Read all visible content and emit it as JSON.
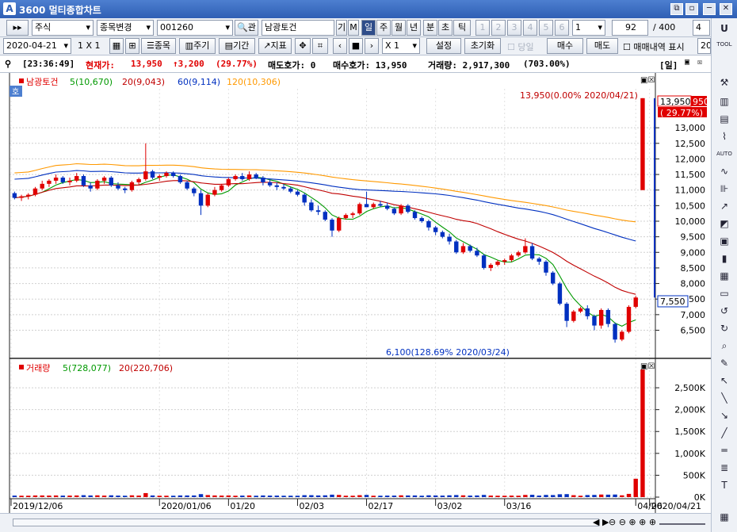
{
  "window": {
    "title": "3600 멀티종합차트",
    "logo": "A",
    "btn_restore": "⧉",
    "btn_min": "─",
    "btn_pin": "▫",
    "btn_close": "✕"
  },
  "toolbar1": {
    "market": "주식",
    "stock_change": "종목변경",
    "code": "001260",
    "search_icon_label": "🔍",
    "tab_sym": "관",
    "stock_name": "남광토건",
    "btn_gi": "기",
    "btn_m": "M",
    "periods": [
      "일",
      "주",
      "월",
      "년",
      "분",
      "초",
      "틱"
    ],
    "selected_period": "일",
    "nums": [
      "1",
      "2",
      "3",
      "4",
      "5",
      "6"
    ],
    "num_select": "1",
    "count": "92",
    "total": "/ 400",
    "extra": "4"
  },
  "toolbar2": {
    "date": "2020-04-21",
    "layout": "1 X 1",
    "btn_stock": "종목",
    "btn_period": "주기",
    "btn_range": "기간",
    "btn_indicator": "지표",
    "zoom": "X 1",
    "btn_settings": "설정",
    "btn_reset": "초기화",
    "chk_today": "당일",
    "btn_buy": "매수",
    "btn_sell": "매도",
    "chk_trades": "매매내역 표시",
    "extra": "20"
  },
  "info": {
    "time": "[23:36:49]",
    "price_label": "현재가:",
    "price": "13,950",
    "change": "↑3,200",
    "change_pct": "(29.77%)",
    "ask_label": "매도호가: 0",
    "bid_label": "매수호가: 13,950",
    "volume_label": "거래량: 2,917,300",
    "volume_pct": "(703.00%)",
    "period_tag": "[일]"
  },
  "price_panel": {
    "legend_name": "남광토건",
    "legend_ma5": "5(10,670)",
    "legend_ma20": "20(9,043)",
    "legend_ma60": "60(9,114)",
    "legend_ma120": "120(10,306)",
    "ho_badge": "호",
    "high_annotation": "13,950(0.00% 2020/04/21)",
    "low_annotation": "6,100(128.69% 2020/03/24)",
    "current_price_tag": "13,950",
    "current_price_tag_suffix": "950",
    "current_pct_tag": "( 29.77%)",
    "marker_price_tag": "7,550"
  },
  "volume_panel": {
    "legend_name": "거래량",
    "legend_ma5": "5(728,077)",
    "legend_ma20": "20(220,706)"
  },
  "chart_data": [
    {
      "type": "candlestick",
      "title": "남광토건",
      "x_tick_labels": [
        "2019/12/06",
        "2020/01/06",
        "01/20",
        "02/03",
        "02/17",
        "03/02",
        "03/16",
        "04/06",
        "2020/04/21"
      ],
      "y_tick_labels": [
        "6,500",
        "7,000",
        "7,500",
        "8,000",
        "8,500",
        "9,000",
        "9,500",
        "10,000",
        "10,500",
        "11,000",
        "11,500",
        "12,000",
        "12,500",
        "13,000"
      ],
      "ylim": [
        5800,
        14200
      ],
      "series": [
        {
          "name": "5",
          "values": [
            10670
          ]
        },
        {
          "name": "20",
          "values": [
            9043
          ]
        },
        {
          "name": "60",
          "values": [
            9114
          ]
        },
        {
          "name": "120",
          "values": [
            10306
          ]
        }
      ],
      "candles_ohlc": [
        [
          10900,
          10950,
          10700,
          10750
        ],
        [
          10750,
          10850,
          10650,
          10800
        ],
        [
          10800,
          10900,
          10700,
          10850
        ],
        [
          10850,
          11100,
          10800,
          11050
        ],
        [
          11050,
          11300,
          11000,
          11200
        ],
        [
          11200,
          11350,
          11100,
          11300
        ],
        [
          11300,
          11500,
          11200,
          11400
        ],
        [
          11400,
          11450,
          11200,
          11250
        ],
        [
          11250,
          11400,
          11150,
          11300
        ],
        [
          11300,
          11550,
          11250,
          11450
        ],
        [
          11450,
          11500,
          11100,
          11150
        ],
        [
          11150,
          11250,
          10950,
          11050
        ],
        [
          11050,
          11350,
          11000,
          11300
        ],
        [
          11300,
          11450,
          11200,
          11400
        ],
        [
          11400,
          11450,
          11100,
          11150
        ],
        [
          11150,
          11250,
          11000,
          11050
        ],
        [
          11050,
          11100,
          10900,
          11000
        ],
        [
          11000,
          11300,
          10950,
          11250
        ],
        [
          11250,
          11400,
          11150,
          11350
        ],
        [
          11350,
          12500,
          11300,
          11600
        ],
        [
          11600,
          11650,
          11350,
          11400
        ],
        [
          11400,
          11500,
          11300,
          11450
        ],
        [
          11450,
          11600,
          11400,
          11550
        ],
        [
          11550,
          11600,
          11400,
          11450
        ],
        [
          11450,
          11500,
          11200,
          11250
        ],
        [
          11250,
          11300,
          11000,
          11050
        ],
        [
          11050,
          11100,
          10800,
          10900
        ],
        [
          10900,
          11000,
          10200,
          10500
        ],
        [
          10500,
          10900,
          10450,
          10850
        ],
        [
          10850,
          11100,
          10800,
          11000
        ],
        [
          11000,
          11200,
          10950,
          11150
        ],
        [
          11150,
          11400,
          11100,
          11350
        ],
        [
          11350,
          11500,
          11300,
          11450
        ],
        [
          11450,
          11550,
          11300,
          11350
        ],
        [
          11350,
          11600,
          11300,
          11500
        ],
        [
          11500,
          11550,
          11350,
          11400
        ],
        [
          11400,
          11450,
          11150,
          11250
        ],
        [
          11250,
          11350,
          11100,
          11150
        ],
        [
          11150,
          11250,
          11000,
          11100
        ],
        [
          11100,
          11200,
          11000,
          11050
        ],
        [
          11050,
          11100,
          10900,
          10950
        ],
        [
          10950,
          11000,
          10800,
          10850
        ],
        [
          10850,
          10900,
          10500,
          10600
        ],
        [
          10600,
          10700,
          10300,
          10350
        ],
        [
          10350,
          10500,
          10200,
          10300
        ],
        [
          10300,
          10350,
          10000,
          10050
        ],
        [
          10050,
          10100,
          9500,
          9700
        ],
        [
          9700,
          10150,
          9650,
          10100
        ],
        [
          10100,
          10250,
          10050,
          10200
        ],
        [
          10200,
          10300,
          10100,
          10250
        ],
        [
          10250,
          10600,
          10200,
          10550
        ],
        [
          10550,
          10950,
          10450,
          10450
        ],
        [
          10450,
          10600,
          10400,
          10550
        ],
        [
          10550,
          10650,
          10450,
          10500
        ],
        [
          10500,
          10600,
          10350,
          10400
        ],
        [
          10400,
          10450,
          10200,
          10250
        ],
        [
          10250,
          10550,
          10200,
          10500
        ],
        [
          10500,
          10550,
          10250,
          10300
        ],
        [
          10300,
          10350,
          10050,
          10100
        ],
        [
          10100,
          10150,
          9950,
          10000
        ],
        [
          10000,
          10050,
          9700,
          9800
        ],
        [
          9800,
          9850,
          9550,
          9650
        ],
        [
          9650,
          9700,
          9450,
          9500
        ],
        [
          9500,
          9600,
          9250,
          9350
        ],
        [
          9350,
          9400,
          8950,
          9000
        ],
        [
          9000,
          9300,
          8950,
          9200
        ],
        [
          9200,
          9250,
          9000,
          9050
        ],
        [
          9050,
          9150,
          8850,
          8900
        ],
        [
          8900,
          8950,
          8450,
          8500
        ],
        [
          8500,
          8650,
          8400,
          8600
        ],
        [
          8600,
          8750,
          8550,
          8700
        ],
        [
          8700,
          8800,
          8600,
          8750
        ],
        [
          8750,
          8950,
          8700,
          8900
        ],
        [
          8900,
          9050,
          8850,
          9000
        ],
        [
          9000,
          9450,
          8950,
          9200
        ],
        [
          9200,
          9300,
          8750,
          8800
        ],
        [
          8800,
          8850,
          8600,
          8700
        ],
        [
          8700,
          8750,
          8250,
          8350
        ],
        [
          8350,
          8400,
          7950,
          8000
        ],
        [
          8000,
          8050,
          7300,
          7350
        ],
        [
          7350,
          7400,
          6600,
          6800
        ],
        [
          6800,
          7150,
          6750,
          7100
        ],
        [
          7100,
          7250,
          7050,
          7200
        ],
        [
          7200,
          7300,
          6850,
          6950
        ],
        [
          6950,
          7000,
          6500,
          6650
        ],
        [
          6650,
          7200,
          6550,
          7150
        ],
        [
          7150,
          7200,
          6600,
          6700
        ],
        [
          6700,
          6750,
          6100,
          6200
        ],
        [
          6200,
          6500,
          6150,
          6450
        ],
        [
          6450,
          7300,
          6400,
          7250
        ],
        [
          7250,
          7600,
          7200,
          7550
        ]
      ]
    },
    {
      "type": "bar",
      "title": "거래량",
      "y_tick_labels": [
        "0K",
        "500K",
        "1,000K",
        "1,500K",
        "2,000K",
        "2,500K"
      ],
      "ylim": [
        0,
        2900000
      ],
      "series": [
        {
          "name": "5",
          "values": [
            728077
          ]
        },
        {
          "name": "20",
          "values": [
            220706
          ]
        }
      ],
      "last_value": 2917300
    }
  ],
  "status": {
    "page_controls": "◀ ▶",
    "zoom_controls": "⊖ ⊖ ⊕ ⊕ ⊕"
  },
  "rightbar": {
    "tool_label": "TOOL",
    "auto_label": "AUTO",
    "u_label": "U"
  }
}
